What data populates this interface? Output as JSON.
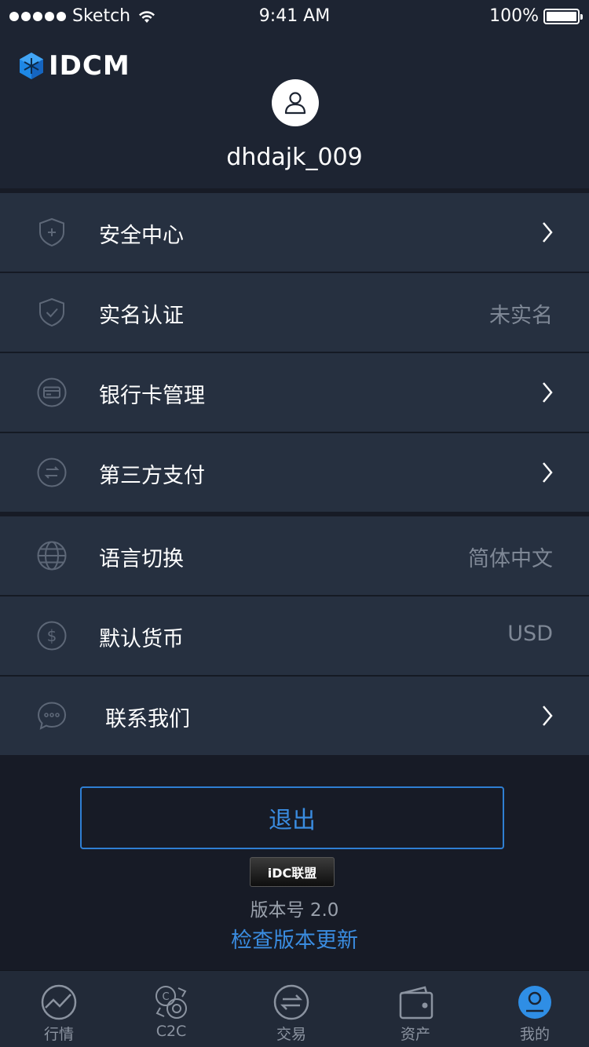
{
  "status_bar": {
    "carrier": "Sketch",
    "time": "9:41 AM",
    "battery": "100%"
  },
  "header": {
    "logo_text": "IDCM",
    "username": "dhdajk_009"
  },
  "menu_group1": [
    {
      "icon": "shield-plus-icon",
      "label": "安全中心",
      "value": "",
      "chevron": true
    },
    {
      "icon": "shield-check-icon",
      "label": "实名认证",
      "value": "未实名",
      "chevron": false
    },
    {
      "icon": "bank-card-icon",
      "label": "银行卡管理",
      "value": "",
      "chevron": true
    },
    {
      "icon": "exchange-icon",
      "label": "第三方支付",
      "value": "",
      "chevron": true
    }
  ],
  "menu_group2": [
    {
      "icon": "globe-icon",
      "label": "语言切换",
      "value": "简体中文",
      "chevron": false
    },
    {
      "icon": "dollar-icon",
      "label": "默认货币",
      "value": "USD",
      "chevron": false
    },
    {
      "icon": "chat-icon",
      "label": "联系我们",
      "value": "",
      "chevron": true
    }
  ],
  "footer": {
    "logout_label": "退出",
    "badge_text": "iDC联盟",
    "version": "版本号 2.0",
    "check_update": "检查版本更新"
  },
  "tabbar": [
    {
      "icon": "market-icon",
      "label": "行情",
      "active": false
    },
    {
      "icon": "c2c-icon",
      "label": "C2C",
      "active": false
    },
    {
      "icon": "trade-icon",
      "label": "交易",
      "active": false
    },
    {
      "icon": "wallet-icon",
      "label": "资产",
      "active": false
    },
    {
      "icon": "profile-icon",
      "label": "我的",
      "active": true
    }
  ],
  "colors": {
    "accent": "#3a8ce0",
    "row_bg": "#263040",
    "header_bg": "#1d2432",
    "page_bg": "#171b26"
  }
}
